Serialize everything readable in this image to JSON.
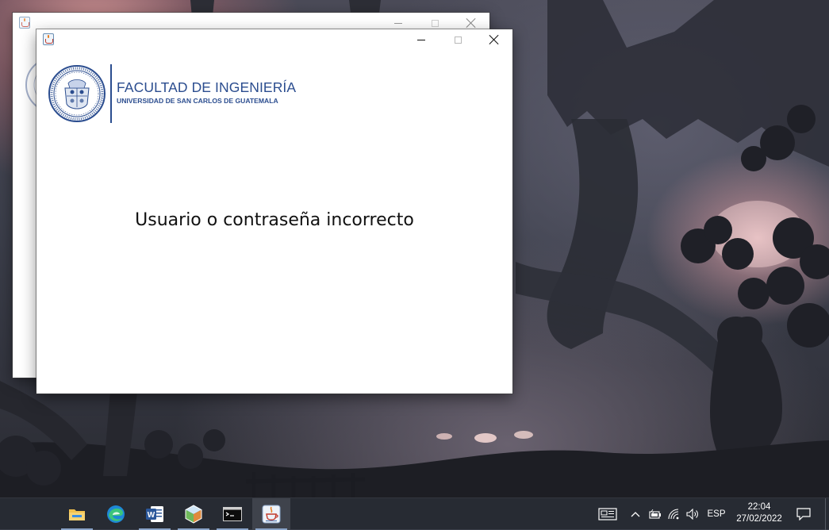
{
  "back_window": {
    "title": "",
    "controls": [
      "minimize",
      "maximize",
      "close"
    ]
  },
  "dialog_window": {
    "title": "",
    "controls": [
      "minimize",
      "maximize",
      "close"
    ],
    "logo": {
      "title": "FACULTAD DE INGENIERÍA",
      "subtitle": "UNIVERSIDAD DE SAN CARLOS DE GUATEMALA"
    },
    "message": "Usuario o contraseña incorrecto"
  },
  "taskbar": {
    "apps": [
      {
        "name": "file-explorer",
        "icon": "folder-icon"
      },
      {
        "name": "edge",
        "icon": "edge-icon"
      },
      {
        "name": "word",
        "icon": "word-icon"
      },
      {
        "name": "netbeans",
        "icon": "cube-icon"
      },
      {
        "name": "terminal",
        "icon": "terminal-icon"
      },
      {
        "name": "java",
        "icon": "java-icon",
        "active": true
      }
    ],
    "tray": {
      "language": "ESP",
      "time": "22:04",
      "date": "27/02/2022"
    }
  },
  "colors": {
    "brand_blue": "#2b4d8f",
    "taskbar": "#272b33",
    "accent_underline": "#8aa4c8"
  }
}
